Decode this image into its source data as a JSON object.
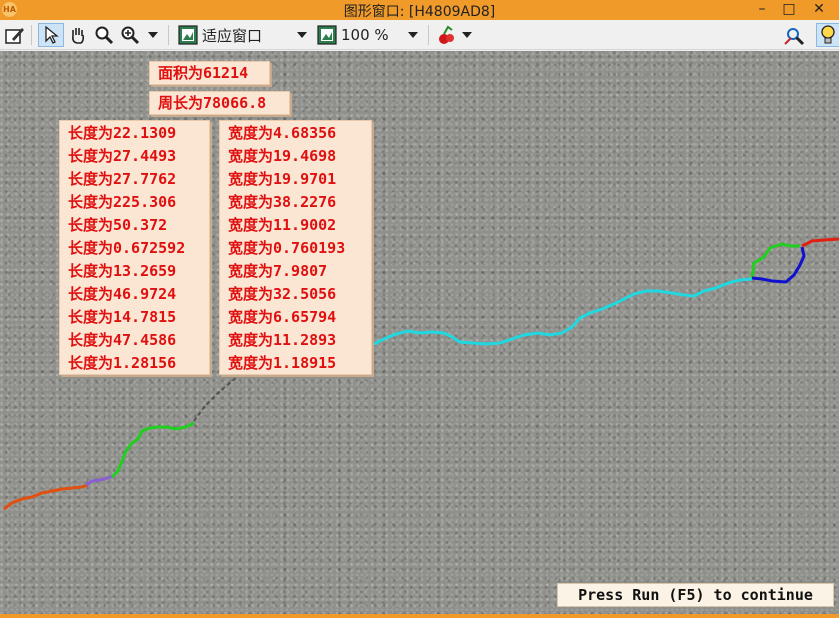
{
  "window": {
    "title": "图形窗口: [H4809AD8]",
    "app_icon_text": "HA",
    "buttons": {
      "minimize": "–",
      "maximize": "□",
      "close": "✕"
    }
  },
  "toolbar": {
    "fit_window_label": "适应窗口",
    "zoom_label": "100 %"
  },
  "overlay": {
    "area": "面积为61214",
    "perimeter": "周长为78066.8",
    "lengths": [
      "长度为22.1309",
      "长度为27.4493",
      "长度为27.7762",
      "长度为225.306",
      "长度为50.372",
      "长度为0.672592",
      "长度为13.2659",
      "长度为46.9724",
      "长度为14.7815",
      "长度为47.4586",
      "长度为1.28156"
    ],
    "widths": [
      "宽度为4.68356",
      "宽度为19.4698",
      "宽度为19.9701",
      "宽度为38.2276",
      "宽度为11.9002",
      "宽度为0.760193",
      "宽度为7.9807",
      "宽度为32.5056",
      "宽度为6.65794",
      "宽度为11.2893",
      "宽度为1.18915"
    ],
    "continue_message": "Press Run (F5) to continue"
  },
  "colors": {
    "title_bar": "#f09a2a",
    "overlay_text": "#e01010",
    "overlay_bg": "#fbe6d3",
    "crack_cyan": "#20d8e0",
    "crack_green": "#20d020",
    "crack_blue": "#1010d0",
    "crack_red": "#e02010",
    "crack_orange": "#e05010",
    "crack_purple": "#8a60d0"
  },
  "icons": [
    "edit-icon",
    "pointer-icon",
    "hand-pan-icon",
    "magnifier-icon",
    "zoom-in-icon",
    "fit-window-icon",
    "zoom-image-icon",
    "color-picker-icon",
    "locate-icon",
    "lightbulb-icon"
  ]
}
